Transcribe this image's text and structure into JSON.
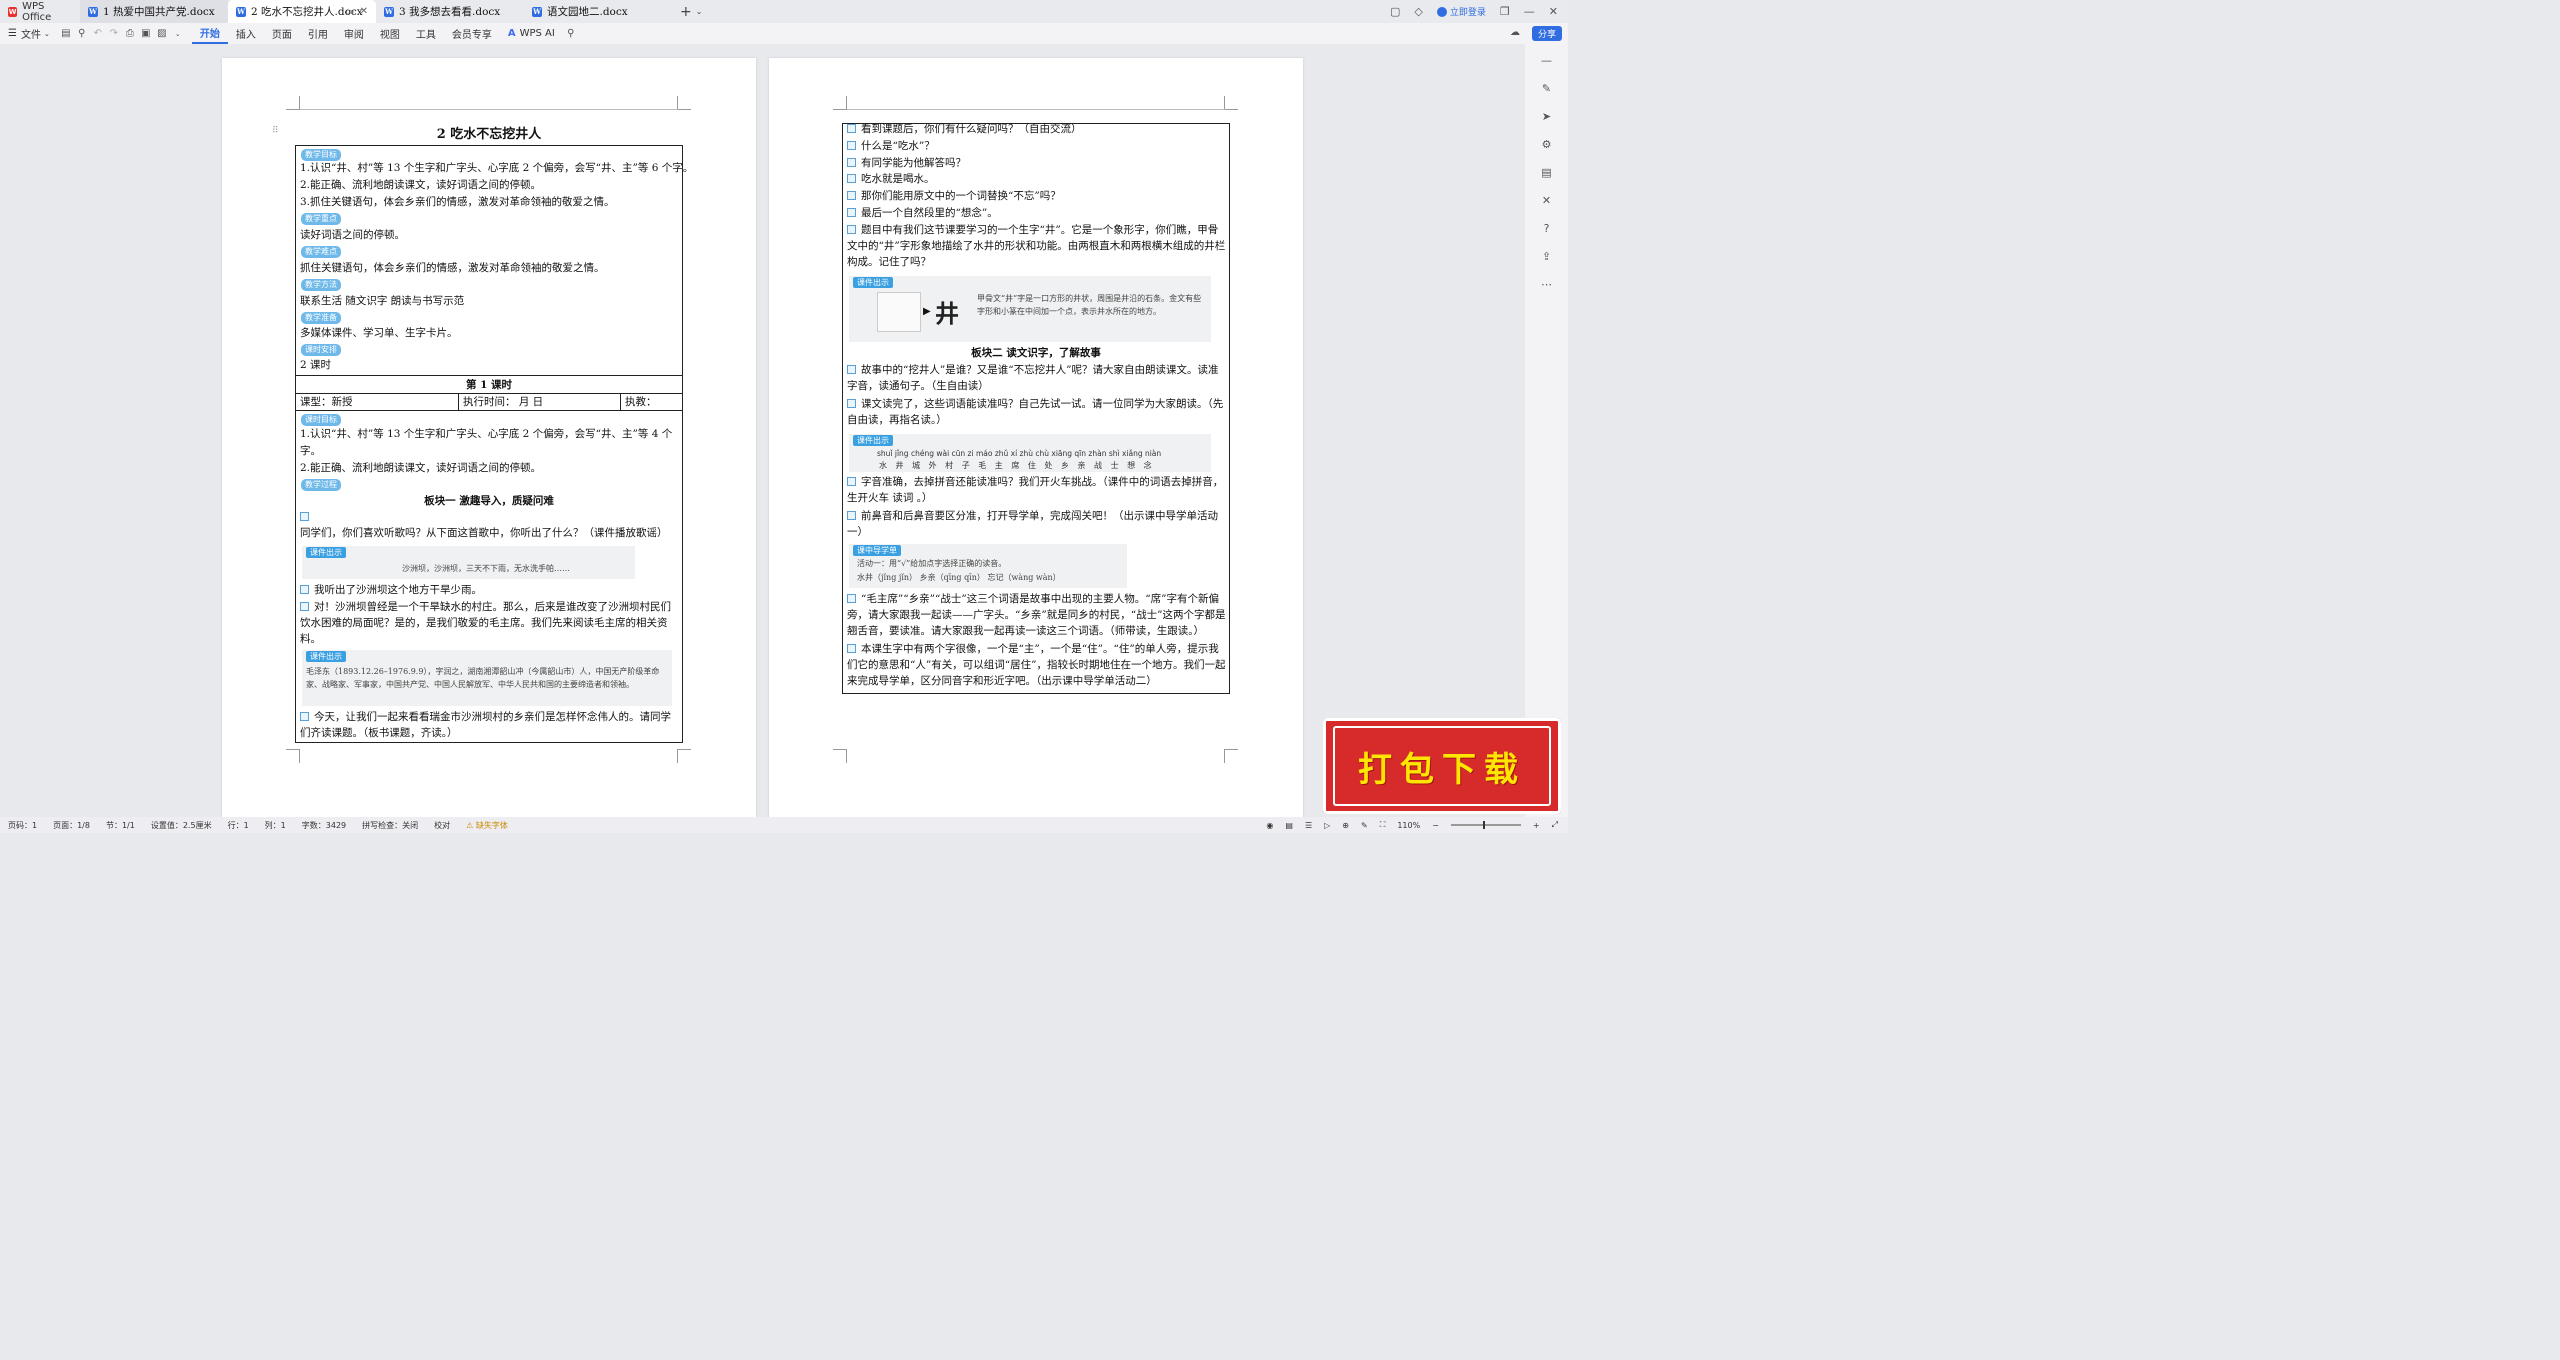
{
  "titlebar": {
    "brand": "WPS Office",
    "tabs": [
      {
        "label": "1 热爱中国共产党.docx"
      },
      {
        "label": "2 吃水不忘挖井人.docx"
      },
      {
        "label": "3 我多想去看看.docx"
      },
      {
        "label": "语文园地二.docx"
      }
    ],
    "add_tab": "+",
    "login": "立即登录"
  },
  "toolbar": {
    "file": "文件",
    "menus": [
      "开始",
      "插入",
      "页面",
      "引用",
      "审阅",
      "视图",
      "工具",
      "会员专享"
    ],
    "ai": "WPS AI",
    "share": "分享"
  },
  "page1": {
    "title": "2  吃水不忘挖井人",
    "tag_goal": "教学目标",
    "goal_1": "1.认识“井、村”等 13 个生字和广字头、心字底 2 个偏旁，会写“井、主”等 6 个字。",
    "goal_2": "2.能正确、流利地朗读课文，读好词语之间的停顿。",
    "goal_3": "3.抓住关键语句，体会乡亲们的情感，激发对革命领袖的敬爱之情。",
    "tag_key": "教学重点",
    "key_1": "读好词语之间的停顿。",
    "tag_diff": "教学难点",
    "diff_1": "抓住关键语句，体会乡亲们的情感，激发对革命领袖的敬爱之情。",
    "tag_method": "教学方法",
    "method_1": "联系生活  随文识字  朗读与书写示范",
    "tag_prep": "教学准备",
    "prep_1": "多媒体课件、学习单、生字卡片。",
    "tag_time": "课时安排",
    "time_1": "2 课时",
    "lesson_title": "第 1 课时",
    "row_type": "课型：新授",
    "row_time": "执行时间：        月       日",
    "row_teacher": "执教：",
    "tag_lgoal": "课时目标",
    "lgoal_1": "1.认识“井、村”等 13 个生字和广字头、心字底 2 个偏旁，会写“井、主”等 4 个",
    "lgoal_1b": "字。",
    "lgoal_2": "2.能正确、流利地朗读课文，读好词语之间的停顿。",
    "tag_process": "教学过程",
    "section1": "板块一  激趣导入，质疑问难",
    "p1": "同学们，你们喜欢听歌吗？从下面这首歌中，你听出了什么？（课件播放歌谣）",
    "kj_label": "课件出示",
    "song": "沙洲坝，沙洲坝，三天不下雨，无水洗手帕……",
    "p2": "我听出了沙洲坝这个地方干旱少雨。",
    "p3": "对！沙洲坝曾经是一个干旱缺水的村庄。那么，后来是谁改变了沙洲坝村民们饮水困难的局面呢？是的，是我们敬爱的毛主席。我们先来阅读毛主席的相关资料。",
    "mao": "毛泽东（1893.12.26–1976.9.9），字润之，湖南湘潭韶山冲（今属韶山市）人，中国无产阶级革命家、战略家、军事家，中国共产党、中国人民解放军、中华人民共和国的主要缔造者和领袖。",
    "p4": "今天，让我们一起来看看瑞金市沙洲坝村的乡亲们是怎样怀念伟人的。请同学们齐读课题。（板书课题，齐读。）"
  },
  "page2": {
    "l1": "看到课题后，你们有什么疑问吗？（自由交流）",
    "l2": "什么是“吃水”？",
    "l3": "有同学能为他解答吗？",
    "l4": "吃水就是喝水。",
    "l5": "那你们能用原文中的一个词替换“不忘”吗？",
    "l6": "最后一个自然段里的“想念”。",
    "l7": "题目中有我们这节课要学习的一个生字“井”。它是一个象形字，你们瞧，甲骨文中的“井”字形象地描绘了水井的形状和功能。由两根直木和两根横木组成的井栏构成。记住了吗？",
    "kj_label": "课件出示",
    "jing_char": "井",
    "jing_text": "甲骨文“井”字是一口方形的井状，周围是井沿的石条。金文有些字形和小篆在中间加一个点，表示井水所在的地方。",
    "section2": "板块二  读文识字，了解故事",
    "l8": "故事中的“挖井人”是谁？又是谁“不忘挖井人”呢？请大家自由朗读课文。读准字音，读通句子。（生自由读）",
    "l9": "课文读完了，这些词语能读准吗？自己先试一试。请一位同学为大家朗读。（先自由读，再指名读。）",
    "pinyin_row": "shuǐ jǐng   chéng wài   cūn zi   máo zhǔ xí   zhù chù   xiāng qīn   zhàn shì   xiǎng niàn",
    "hanzi_row": "水 井   城 外   村 子   毛 主 席   住 处   乡 亲   战 士   想 念",
    "l10": "字音准确，去掉拼音还能读准吗？我们开火车挑战。（课件中的词语去掉拼音，生开火车  读词  。）",
    "l11": "前鼻音和后鼻音要区分准，打开导学单，完成闯关吧！（出示课中导学单活动一）",
    "guide_label": "课中导学单",
    "guide_1": "活动一：用“√”给加点字选择正确的读音。",
    "guide_2": "水井（jǐng   jǐn）      乡亲（qīng   qīn）      忘记（wàng   wàn）",
    "l12": "“毛主席”“乡亲”“战士”这三个词语是故事中出现的主要人物。“席”字有个新偏旁，请大家跟我一起读——广字头。“乡亲”就是同乡的村民，“战士”这两个字都是翘舌音，要读准。请大家跟我一起再读一读这三个词语。（师带读，生跟读。）",
    "l13": "本课生字中有两个字很像，一个是“主”，一个是“住”。“住”的单人旁，提示我们它的意思和“人”有关，可以组词“居住”，指较长时期地住在一个地方。我们一起来完成导学单，区分同音字和形近字吧。（出示课中导学单活动二）"
  },
  "statusbar": {
    "page_num": "页码：1",
    "pages": "页面：1/8",
    "section": "节：1/1",
    "setting": "设置值：2.5厘米",
    "row": "行：1",
    "col": "列：1",
    "words": "字数：3429",
    "spell": "拼写检查：关闭",
    "proof": "校对",
    "font_missing": "缺失字体",
    "zoom": "110%"
  },
  "download": {
    "text": "打包下载"
  },
  "colors": {
    "accent": "#2f6de1",
    "tag": "#6eb9e9",
    "badge": "#d72b2b"
  }
}
